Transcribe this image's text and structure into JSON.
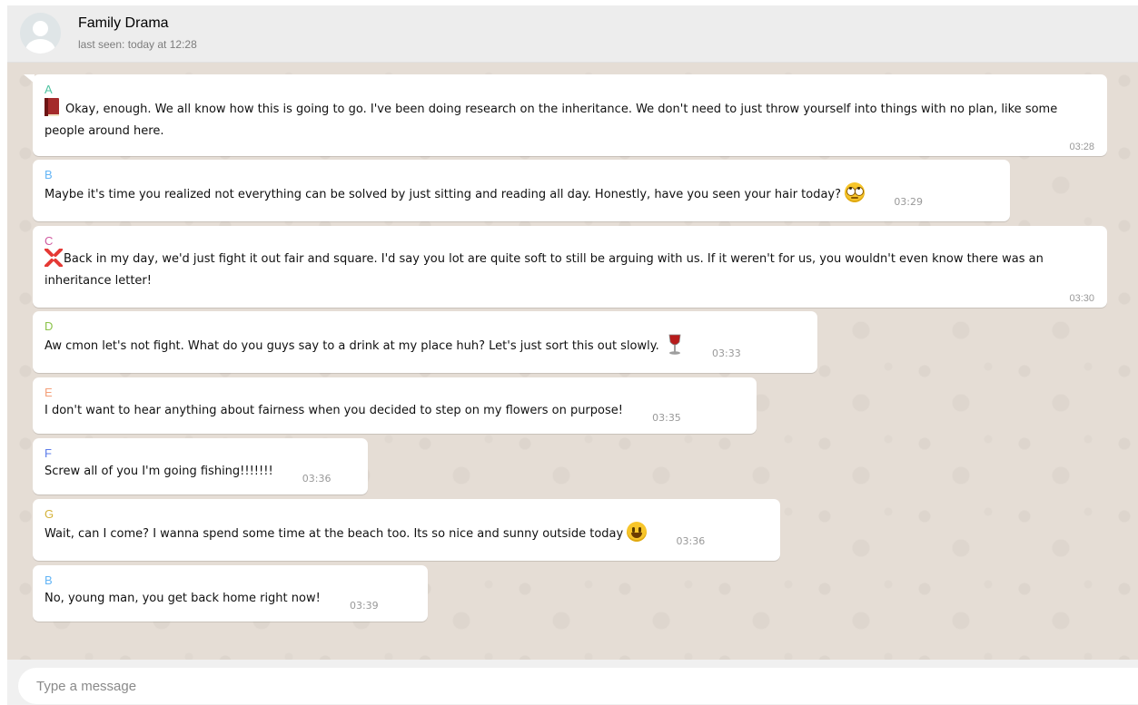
{
  "header": {
    "title": "Family Drama",
    "subtitle": "last seen: today at 12:28"
  },
  "colors": {
    "A": "#4fc3a0",
    "B": "#64b5f6",
    "C": "#d05aa0",
    "D": "#8bc34a",
    "E": "#f4a07a",
    "F": "#5b7bea",
    "G": "#d4b23a"
  },
  "messages": [
    {
      "sender": "A",
      "emoji": "book-icon",
      "text": "Okay, enough. We all know how this is going to go. I've been doing research on the inheritance. We don't need to just throw yourself into things with no plan, like some people around here.",
      "time": "03:28"
    },
    {
      "sender": "B",
      "text": "Maybe it's time you realized not everything can be solved by just sitting and reading all day. Honestly, have you seen your hair today?",
      "emoji": "eye-roll-icon",
      "time": "03:29"
    },
    {
      "sender": "C",
      "emoji": "anger-icon",
      "text": "Back in my day, we'd just fight it out fair and square. I'd say you lot are quite soft to still be arguing with us. If it weren't for us, you wouldn't even know there was an inheritance letter!",
      "time": "03:30"
    },
    {
      "sender": "D",
      "text": "Aw cmon let's not fight. What do you guys say to a drink at my place huh? Let's just sort this out slowly.",
      "emoji": "wine-glass-icon",
      "time": "03:33"
    },
    {
      "sender": "E",
      "text": "I don't want to hear anything about fairness when you decided to step on my flowers on purpose!",
      "time": "03:35"
    },
    {
      "sender": "F",
      "text": "Screw all of you I'm going fishing!!!!!!!",
      "time": "03:36"
    },
    {
      "sender": "G",
      "text": "Wait, can I come? I wanna spend some time at the beach too. Its so nice and sunny outside today",
      "emoji": "smiley-icon",
      "time": "03:36"
    },
    {
      "sender": "B",
      "text": "No, young man, you get back home right now!",
      "time": "03:39"
    }
  ],
  "composer": {
    "placeholder": "Type a message"
  }
}
